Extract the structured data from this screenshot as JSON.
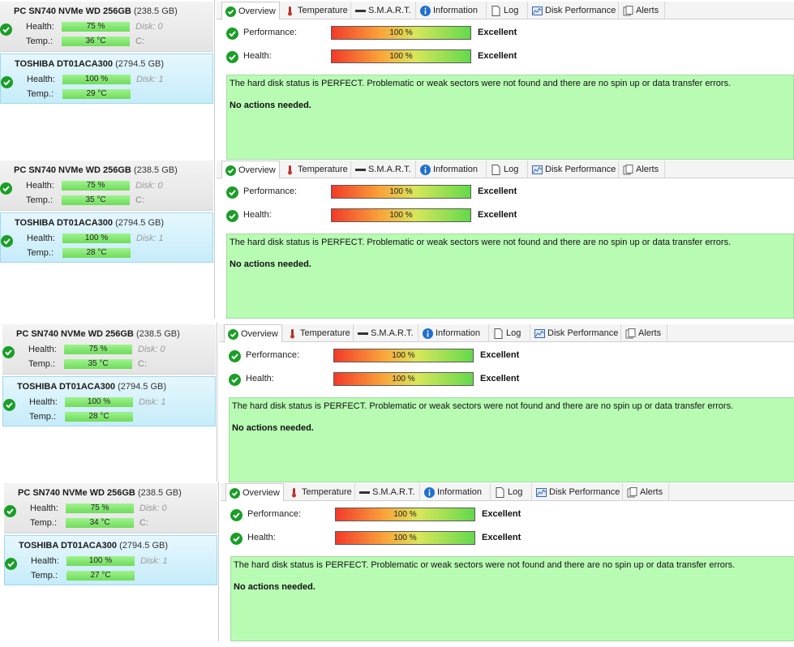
{
  "tabs": {
    "overview": "Overview",
    "temperature": "Temperature",
    "smart": "S.M.A.R.T.",
    "information": "Information",
    "log": "Log",
    "disk_performance": "Disk Performance",
    "alerts": "Alerts"
  },
  "labels": {
    "health": "Health:",
    "temp": "Temp.:",
    "performance": "Performance:",
    "health_row": "Health:"
  },
  "colors": {
    "ok_green": "#1a9e27",
    "status_bg": "#b8fcb4",
    "selected_disk_bg": "#c6ecfa"
  },
  "icons": [
    "check-circle-icon",
    "thermometer-icon",
    "smart-icon",
    "info-icon",
    "log-icon",
    "disk-performance-icon",
    "alerts-icon"
  ],
  "panels": [
    {
      "disks": [
        {
          "name": "PC SN740 NVMe WD 256GB",
          "size": "(238.5 GB)",
          "health": "75 %",
          "health_value": 75,
          "temp": "36 °C",
          "disk": "Disk: 0",
          "drive": "C:"
        },
        {
          "name": "TOSHIBA DT01ACA300",
          "size": "(2794.5 GB)",
          "health": "100 %",
          "health_value": 100,
          "temp": "29 °C",
          "disk": "Disk: 1",
          "drive": ""
        }
      ],
      "performance": {
        "value": "100 %",
        "grade": "Excellent"
      },
      "health": {
        "value": "100 %",
        "grade": "Excellent"
      },
      "status_message": "The hard disk status is PERFECT. Problematic or weak sectors were not found and there are no spin up or data transfer errors.",
      "actions": "No actions needed."
    },
    {
      "disks": [
        {
          "name": "PC SN740 NVMe WD 256GB",
          "size": "(238.5 GB)",
          "health": "75 %",
          "health_value": 75,
          "temp": "35 °C",
          "disk": "Disk: 0",
          "drive": "C:"
        },
        {
          "name": "TOSHIBA DT01ACA300",
          "size": "(2794.5 GB)",
          "health": "100 %",
          "health_value": 100,
          "temp": "28 °C",
          "disk": "Disk: 1",
          "drive": ""
        }
      ],
      "performance": {
        "value": "100 %",
        "grade": "Excellent"
      },
      "health": {
        "value": "100 %",
        "grade": "Excellent"
      },
      "status_message": "The hard disk status is PERFECT. Problematic or weak sectors were not found and there are no spin up or data transfer errors.",
      "actions": "No actions needed."
    },
    {
      "disks": [
        {
          "name": "PC SN740 NVMe WD 256GB",
          "size": "(238.5 GB)",
          "health": "75 %",
          "health_value": 75,
          "temp": "35 °C",
          "disk": "Disk: 0",
          "drive": "C:"
        },
        {
          "name": "TOSHIBA DT01ACA300",
          "size": "(2794.5 GB)",
          "health": "100 %",
          "health_value": 100,
          "temp": "28 °C",
          "disk": "Disk: 1",
          "drive": ""
        }
      ],
      "performance": {
        "value": "100 %",
        "grade": "Excellent"
      },
      "health": {
        "value": "100 %",
        "grade": "Excellent"
      },
      "status_message": "The hard disk status is PERFECT. Problematic or weak sectors were not found and there are no spin up or data transfer errors.",
      "actions": "No actions needed."
    },
    {
      "disks": [
        {
          "name": "PC SN740 NVMe WD 256GB",
          "size": "(238.5 GB)",
          "health": "75 %",
          "health_value": 75,
          "temp": "34 °C",
          "disk": "Disk: 0",
          "drive": "C:"
        },
        {
          "name": "TOSHIBA DT01ACA300",
          "size": "(2794.5 GB)",
          "health": "100 %",
          "health_value": 100,
          "temp": "27 °C",
          "disk": "Disk: 1",
          "drive": ""
        }
      ],
      "performance": {
        "value": "100 %",
        "grade": "Excellent"
      },
      "health": {
        "value": "100 %",
        "grade": "Excellent"
      },
      "status_message": "The hard disk status is PERFECT. Problematic or weak sectors were not found and there are no spin up or data transfer errors.",
      "actions": "No actions needed."
    }
  ]
}
